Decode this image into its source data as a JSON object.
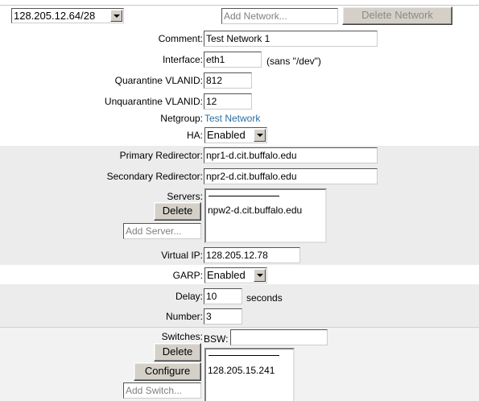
{
  "top_bar": {
    "network_select": "128.205.12.64/28",
    "add_network_placeholder": "Add Network...",
    "delete_network_label": "Delete Network"
  },
  "form": {
    "comment_label": "Comment:",
    "comment_value": "Test Network 1",
    "interface_label": "Interface:",
    "interface_value": "eth1",
    "interface_hint": "(sans \"/dev\")",
    "quarantine_vlan_label": "Quarantine VLANID:",
    "quarantine_vlan_value": "812",
    "unquarantine_vlan_label": "Unquarantine VLANID:",
    "unquarantine_vlan_value": "12",
    "netgroup_label": "Netgroup:",
    "netgroup_value": "Test Network",
    "ha_label": "HA:",
    "ha_value": "Enabled"
  },
  "ha_section": {
    "primary_label": "Primary Redirector:",
    "primary_value": "npr1-d.cit.buffalo.edu",
    "secondary_label": "Secondary Redirector:",
    "secondary_value": "npr2-d.cit.buffalo.edu",
    "servers_label": "Servers:",
    "servers_delete_label": "Delete",
    "add_server_placeholder": "Add Server...",
    "servers_list": [
      "npw2-d.cit.buffalo.edu"
    ],
    "virtual_ip_label": "Virtual IP:",
    "virtual_ip_value": "128.205.12.78"
  },
  "garp": {
    "label": "GARP:",
    "value": "Enabled",
    "delay_label": "Delay:",
    "delay_value": "10",
    "delay_unit": "seconds",
    "number_label": "Number:",
    "number_value": "3"
  },
  "switches": {
    "label": "Switches:",
    "bsw_label": "BSW:",
    "bsw_value": "",
    "delete_label": "Delete",
    "configure_label": "Configure",
    "add_switch_placeholder": "Add Switch...",
    "switch_list": [
      "128.205.15.241"
    ]
  }
}
